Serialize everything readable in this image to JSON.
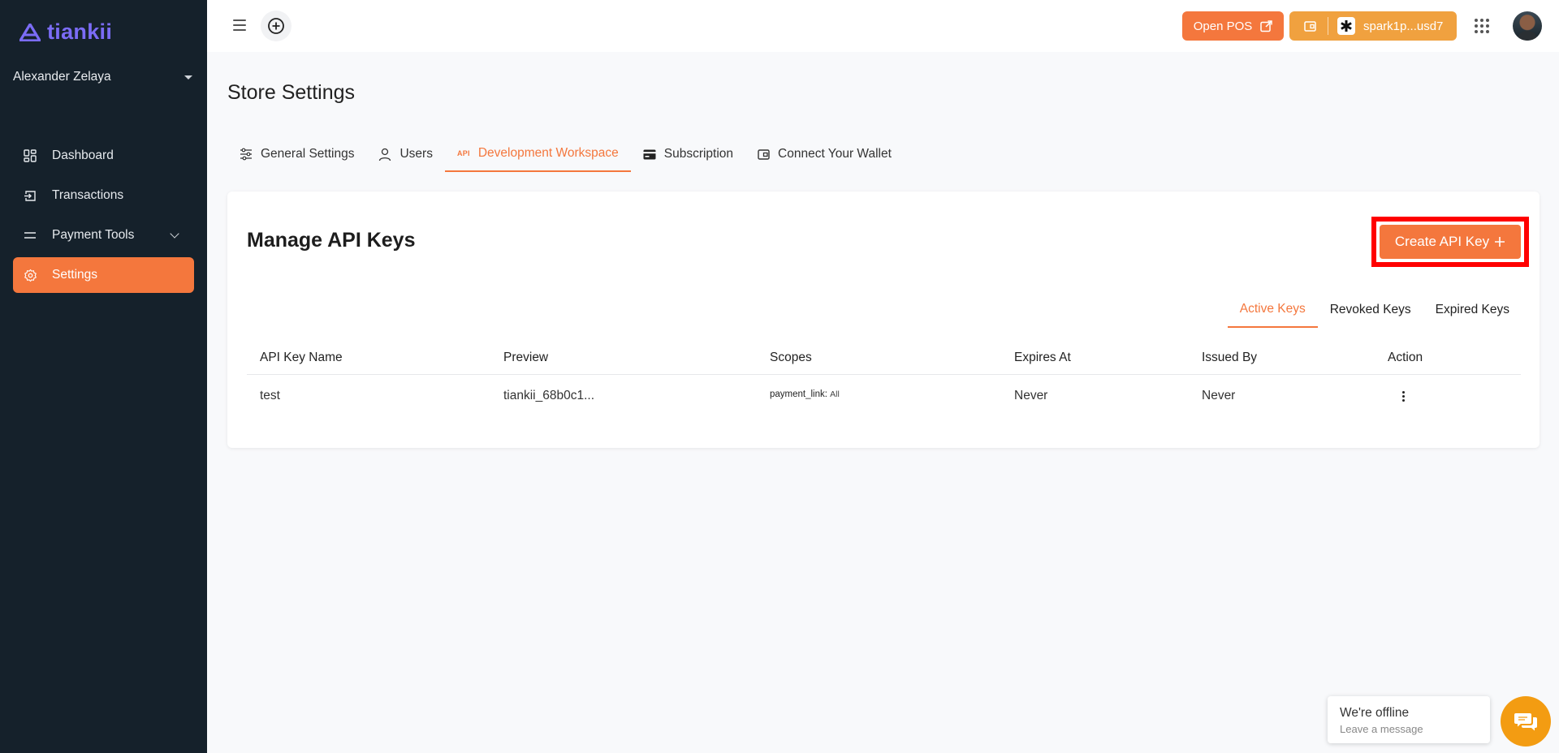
{
  "brand": {
    "name": "tiankii",
    "color": "#7b6cf6"
  },
  "user": {
    "name": "Alexander Zelaya"
  },
  "sidebar": {
    "items": [
      {
        "label": "Dashboard",
        "icon": "dashboard-grid-icon"
      },
      {
        "label": "Transactions",
        "icon": "transactions-icon"
      },
      {
        "label": "Payment Tools",
        "icon": "payment-tools-icon"
      },
      {
        "label": "Settings",
        "icon": "gear-icon",
        "active": true
      }
    ]
  },
  "topbar": {
    "open_pos": "Open POS",
    "wallet": "spark1p...usd7"
  },
  "page": {
    "title": "Store Settings"
  },
  "tabs": [
    {
      "label": "General Settings",
      "icon": "sliders-icon"
    },
    {
      "label": "Users",
      "icon": "user-icon"
    },
    {
      "label": "Development Workspace",
      "icon": "api-icon",
      "icon_text": "API",
      "active": true
    },
    {
      "label": "Subscription",
      "icon": "credit-card-icon"
    },
    {
      "label": "Connect Your Wallet",
      "icon": "wallet-icon"
    }
  ],
  "card": {
    "title": "Manage API Keys",
    "create_button": "Create API Key",
    "subtabs": [
      {
        "label": "Active Keys",
        "active": true
      },
      {
        "label": "Revoked Keys"
      },
      {
        "label": "Expired Keys"
      }
    ],
    "table": {
      "headers": [
        "API Key Name",
        "Preview",
        "Scopes",
        "Expires At",
        "Issued By",
        "Action"
      ],
      "rows": [
        {
          "name": "test",
          "preview": "tiankii_68b0c1...",
          "scope_name": "payment_link:",
          "scope_value": "All",
          "expires": "Never",
          "issued_by": "Never"
        }
      ]
    }
  },
  "chat": {
    "title": "We're offline",
    "subtitle": "Leave a message"
  },
  "colors": {
    "accent": "#f4773d",
    "wallet": "#f0a13f",
    "sidebar": "#15212b",
    "highlight": "#ff0000"
  }
}
